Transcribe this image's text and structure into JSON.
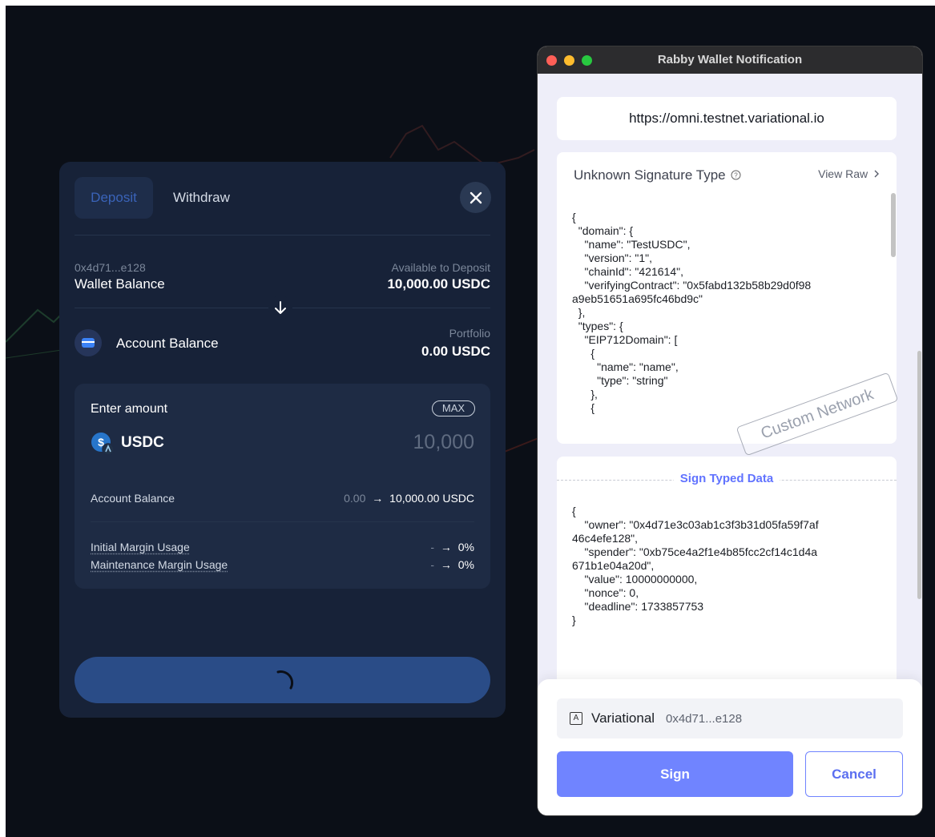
{
  "deposit_modal": {
    "tabs": {
      "deposit": "Deposit",
      "withdraw": "Withdraw"
    },
    "wallet": {
      "address": "0x4d71...e128",
      "label": "Wallet Balance",
      "available_label": "Available to Deposit",
      "available_value": "10,000.00 USDC"
    },
    "account": {
      "label": "Account Balance",
      "portfolio_label": "Portfolio",
      "portfolio_value": "0.00 USDC"
    },
    "amount": {
      "label": "Enter amount",
      "max": "MAX",
      "token": "USDC",
      "value": "10,000"
    },
    "summary": {
      "account_balance_label": "Account Balance",
      "account_balance_from": "0.00",
      "account_balance_to": "10,000.00 USDC",
      "initial_margin_label": "Initial Margin Usage",
      "initial_margin_from": "-",
      "initial_margin_to": "0%",
      "maintenance_margin_label": "Maintenance Margin Usage",
      "maintenance_margin_from": "-",
      "maintenance_margin_to": "0%"
    },
    "arrow_glyph": "→"
  },
  "rabby": {
    "window_title": "Rabby Wallet Notification",
    "origin_url": "https://omni.testnet.variational.io",
    "signature_type": "Unknown Signature Type",
    "view_raw": "View Raw",
    "raw_json": "{\n  \"domain\": {\n    \"name\": \"TestUSDC\",\n    \"version\": \"1\",\n    \"chainId\": \"421614\",\n    \"verifyingContract\": \"0x5fabd132b58b29d0f98\na9eb51651a695fc46bd9c\"\n  },\n  \"types\": {\n    \"EIP712Domain\": [\n      {\n        \"name\": \"name\",\n        \"type\": \"string\"\n      },\n      {",
    "stamp": "Custom Network",
    "sign_typed_data_label": "Sign Typed Data",
    "typed_data": "{\n    \"owner\": \"0x4d71e3c03ab1c3f3b31d05fa59f7af\n46c4efe128\",\n    \"spender\": \"0xb75ce4a2f1e4b85fcc2cf14c1d4a\n671b1e04a20d\",\n    \"value\": 10000000000,\n    \"nonce\": 0,\n    \"deadline\": 1733857753\n}",
    "account_badge": "A",
    "account_name": "Variational",
    "account_address": "0x4d71...e128",
    "sign_label": "Sign",
    "cancel_label": "Cancel"
  },
  "colors": {
    "accent": "#7084ff",
    "modal_bg": "#172238",
    "deposit_tab_text": "#3a63b8"
  }
}
